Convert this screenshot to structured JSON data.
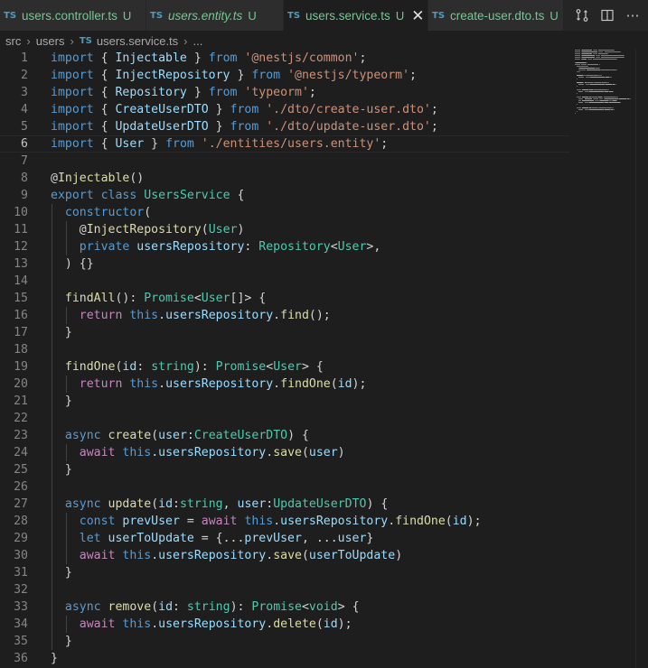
{
  "tabs": [
    {
      "label": "users.controller.ts",
      "badge": "TS",
      "status": "U",
      "dirty": true,
      "italic": false,
      "active": false
    },
    {
      "label": "users.entity.ts",
      "badge": "TS",
      "status": "U",
      "dirty": false,
      "italic": true,
      "active": false
    },
    {
      "label": "users.service.ts",
      "badge": "TS",
      "status": "U",
      "dirty": false,
      "italic": false,
      "active": true
    },
    {
      "label": "create-user.dto.ts",
      "badge": "TS",
      "status": "U",
      "dirty": false,
      "italic": false,
      "active": false
    }
  ],
  "tab_actions": {
    "compare_icon": "git-compare-icon",
    "split_icon": "split-editor-icon",
    "more_label": "⋯"
  },
  "breadcrumb": {
    "items": [
      "src",
      "users"
    ],
    "file_badge": "TS",
    "file": "users.service.ts",
    "trail": "..."
  },
  "editor": {
    "current_line": 6,
    "lines": [
      [
        [
          "kw",
          "import"
        ],
        [
          "pl",
          " { "
        ],
        [
          "var",
          "Injectable"
        ],
        [
          "pl",
          " } "
        ],
        [
          "kw",
          "from"
        ],
        [
          "pl",
          " "
        ],
        [
          "str",
          "'@nestjs/common'"
        ],
        [
          "pl",
          ";"
        ]
      ],
      [
        [
          "kw",
          "import"
        ],
        [
          "pl",
          " { "
        ],
        [
          "var",
          "InjectRepository"
        ],
        [
          "pl",
          " } "
        ],
        [
          "kw",
          "from"
        ],
        [
          "pl",
          " "
        ],
        [
          "str",
          "'@nestjs/typeorm'"
        ],
        [
          "pl",
          ";"
        ]
      ],
      [
        [
          "kw",
          "import"
        ],
        [
          "pl",
          " { "
        ],
        [
          "var",
          "Repository"
        ],
        [
          "pl",
          " } "
        ],
        [
          "kw",
          "from"
        ],
        [
          "pl",
          " "
        ],
        [
          "str",
          "'typeorm'"
        ],
        [
          "pl",
          ";"
        ]
      ],
      [
        [
          "kw",
          "import"
        ],
        [
          "pl",
          " { "
        ],
        [
          "var",
          "CreateUserDTO"
        ],
        [
          "pl",
          " } "
        ],
        [
          "kw",
          "from"
        ],
        [
          "pl",
          " "
        ],
        [
          "str",
          "'./dto/create-user.dto'"
        ],
        [
          "pl",
          ";"
        ]
      ],
      [
        [
          "kw",
          "import"
        ],
        [
          "pl",
          " { "
        ],
        [
          "var",
          "UpdateUserDTO"
        ],
        [
          "pl",
          " } "
        ],
        [
          "kw",
          "from"
        ],
        [
          "pl",
          " "
        ],
        [
          "str",
          "'./dto/update-user.dto'"
        ],
        [
          "pl",
          ";"
        ]
      ],
      [
        [
          "kw",
          "import"
        ],
        [
          "pl",
          " { "
        ],
        [
          "var",
          "User"
        ],
        [
          "pl",
          " } "
        ],
        [
          "kw",
          "from"
        ],
        [
          "pl",
          " "
        ],
        [
          "str",
          "'./entities/users.entity'"
        ],
        [
          "pl",
          ";"
        ]
      ],
      [],
      [
        [
          "pl",
          "@"
        ],
        [
          "fn",
          "Injectable"
        ],
        [
          "pl",
          "()"
        ]
      ],
      [
        [
          "kw",
          "export"
        ],
        [
          "pl",
          " "
        ],
        [
          "kw",
          "class"
        ],
        [
          "pl",
          " "
        ],
        [
          "typ",
          "UsersService"
        ],
        [
          "pl",
          " {"
        ]
      ],
      [
        [
          "pl",
          "  "
        ],
        [
          "kw",
          "constructor"
        ],
        [
          "pl",
          "("
        ]
      ],
      [
        [
          "pl",
          "    @"
        ],
        [
          "fn",
          "InjectRepository"
        ],
        [
          "pl",
          "("
        ],
        [
          "typ",
          "User"
        ],
        [
          "pl",
          ")"
        ]
      ],
      [
        [
          "pl",
          "    "
        ],
        [
          "kw",
          "private"
        ],
        [
          "pl",
          " "
        ],
        [
          "var",
          "usersRepository"
        ],
        [
          "pl",
          ": "
        ],
        [
          "typ",
          "Repository"
        ],
        [
          "pl",
          "<"
        ],
        [
          "typ",
          "User"
        ],
        [
          "pl",
          ">,"
        ]
      ],
      [
        [
          "pl",
          "  ) {}"
        ]
      ],
      [],
      [
        [
          "pl",
          "  "
        ],
        [
          "fn",
          "findAll"
        ],
        [
          "pl",
          "(): "
        ],
        [
          "typ",
          "Promise"
        ],
        [
          "pl",
          "<"
        ],
        [
          "typ",
          "User"
        ],
        [
          "pl",
          "[]> {"
        ]
      ],
      [
        [
          "pl",
          "    "
        ],
        [
          "ctl",
          "return"
        ],
        [
          "pl",
          " "
        ],
        [
          "kw",
          "this"
        ],
        [
          "pl",
          "."
        ],
        [
          "var",
          "usersRepository"
        ],
        [
          "pl",
          "."
        ],
        [
          "fn",
          "find"
        ],
        [
          "pl",
          "();"
        ]
      ],
      [
        [
          "pl",
          "  }"
        ]
      ],
      [],
      [
        [
          "pl",
          "  "
        ],
        [
          "fn",
          "findOne"
        ],
        [
          "pl",
          "("
        ],
        [
          "var",
          "id"
        ],
        [
          "pl",
          ": "
        ],
        [
          "typ",
          "string"
        ],
        [
          "pl",
          "): "
        ],
        [
          "typ",
          "Promise"
        ],
        [
          "pl",
          "<"
        ],
        [
          "typ",
          "User"
        ],
        [
          "pl",
          "> {"
        ]
      ],
      [
        [
          "pl",
          "    "
        ],
        [
          "ctl",
          "return"
        ],
        [
          "pl",
          " "
        ],
        [
          "kw",
          "this"
        ],
        [
          "pl",
          "."
        ],
        [
          "var",
          "usersRepository"
        ],
        [
          "pl",
          "."
        ],
        [
          "fn",
          "findOne"
        ],
        [
          "pl",
          "("
        ],
        [
          "var",
          "id"
        ],
        [
          "pl",
          ");"
        ]
      ],
      [
        [
          "pl",
          "  }"
        ]
      ],
      [],
      [
        [
          "pl",
          "  "
        ],
        [
          "kw",
          "async"
        ],
        [
          "pl",
          " "
        ],
        [
          "fn",
          "create"
        ],
        [
          "pl",
          "("
        ],
        [
          "var",
          "user"
        ],
        [
          "pl",
          ":"
        ],
        [
          "typ",
          "CreateUserDTO"
        ],
        [
          "pl",
          ") {"
        ]
      ],
      [
        [
          "pl",
          "    "
        ],
        [
          "ctl",
          "await"
        ],
        [
          "pl",
          " "
        ],
        [
          "kw",
          "this"
        ],
        [
          "pl",
          "."
        ],
        [
          "var",
          "usersRepository"
        ],
        [
          "pl",
          "."
        ],
        [
          "fn",
          "save"
        ],
        [
          "pl",
          "("
        ],
        [
          "var",
          "user"
        ],
        [
          "pl",
          ")"
        ]
      ],
      [
        [
          "pl",
          "  }"
        ]
      ],
      [],
      [
        [
          "pl",
          "  "
        ],
        [
          "kw",
          "async"
        ],
        [
          "pl",
          " "
        ],
        [
          "fn",
          "update"
        ],
        [
          "pl",
          "("
        ],
        [
          "var",
          "id"
        ],
        [
          "pl",
          ":"
        ],
        [
          "typ",
          "string"
        ],
        [
          "pl",
          ", "
        ],
        [
          "var",
          "user"
        ],
        [
          "pl",
          ":"
        ],
        [
          "typ",
          "UpdateUserDTO"
        ],
        [
          "pl",
          ") {"
        ]
      ],
      [
        [
          "pl",
          "    "
        ],
        [
          "kw",
          "const"
        ],
        [
          "pl",
          " "
        ],
        [
          "var",
          "prevUser"
        ],
        [
          "pl",
          " = "
        ],
        [
          "ctl",
          "await"
        ],
        [
          "pl",
          " "
        ],
        [
          "kw",
          "this"
        ],
        [
          "pl",
          "."
        ],
        [
          "var",
          "usersRepository"
        ],
        [
          "pl",
          "."
        ],
        [
          "fn",
          "findOne"
        ],
        [
          "pl",
          "("
        ],
        [
          "var",
          "id"
        ],
        [
          "pl",
          ");"
        ]
      ],
      [
        [
          "pl",
          "    "
        ],
        [
          "kw",
          "let"
        ],
        [
          "pl",
          " "
        ],
        [
          "var",
          "userToUpdate"
        ],
        [
          "pl",
          " = {..."
        ],
        [
          "var",
          "prevUser"
        ],
        [
          "pl",
          ", ..."
        ],
        [
          "var",
          "user"
        ],
        [
          "pl",
          "}"
        ]
      ],
      [
        [
          "pl",
          "    "
        ],
        [
          "ctl",
          "await"
        ],
        [
          "pl",
          " "
        ],
        [
          "kw",
          "this"
        ],
        [
          "pl",
          "."
        ],
        [
          "var",
          "usersRepository"
        ],
        [
          "pl",
          "."
        ],
        [
          "fn",
          "save"
        ],
        [
          "pl",
          "("
        ],
        [
          "var",
          "userToUpdate"
        ],
        [
          "pl",
          ")"
        ]
      ],
      [
        [
          "pl",
          "  }"
        ]
      ],
      [],
      [
        [
          "pl",
          "  "
        ],
        [
          "kw",
          "async"
        ],
        [
          "pl",
          " "
        ],
        [
          "fn",
          "remove"
        ],
        [
          "pl",
          "("
        ],
        [
          "var",
          "id"
        ],
        [
          "pl",
          ": "
        ],
        [
          "typ",
          "string"
        ],
        [
          "pl",
          "): "
        ],
        [
          "typ",
          "Promise"
        ],
        [
          "pl",
          "<"
        ],
        [
          "typ",
          "void"
        ],
        [
          "pl",
          "> {"
        ]
      ],
      [
        [
          "pl",
          "    "
        ],
        [
          "ctl",
          "await"
        ],
        [
          "pl",
          " "
        ],
        [
          "kw",
          "this"
        ],
        [
          "pl",
          "."
        ],
        [
          "var",
          "usersRepository"
        ],
        [
          "pl",
          "."
        ],
        [
          "fn",
          "delete"
        ],
        [
          "pl",
          "("
        ],
        [
          "var",
          "id"
        ],
        [
          "pl",
          ");"
        ]
      ],
      [
        [
          "pl",
          "  }"
        ]
      ],
      [
        [
          "pl",
          "}"
        ]
      ]
    ]
  },
  "colors": {
    "background": "#1e1e1e",
    "keyword": "#569cd6",
    "control": "#c586c0",
    "string": "#ce9178",
    "variable": "#9cdcfe",
    "function": "#dcdcaa",
    "type": "#4ec9b0",
    "untracked": "#73c991"
  }
}
